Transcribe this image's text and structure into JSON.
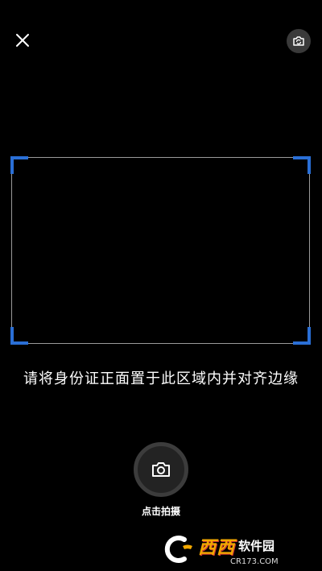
{
  "top_bar": {
    "close_icon": "close-icon",
    "switch_camera_icon": "camera-switch-icon"
  },
  "frame": {
    "corner_color": "#2a6fd6"
  },
  "hint": {
    "text": "请将身份证正面置于此区域内并对齐边缘"
  },
  "shutter": {
    "icon": "camera-icon",
    "label": "点击拍摄"
  },
  "watermark": {
    "brand": "西西",
    "site": "软件园",
    "url": "CR173.COM"
  }
}
